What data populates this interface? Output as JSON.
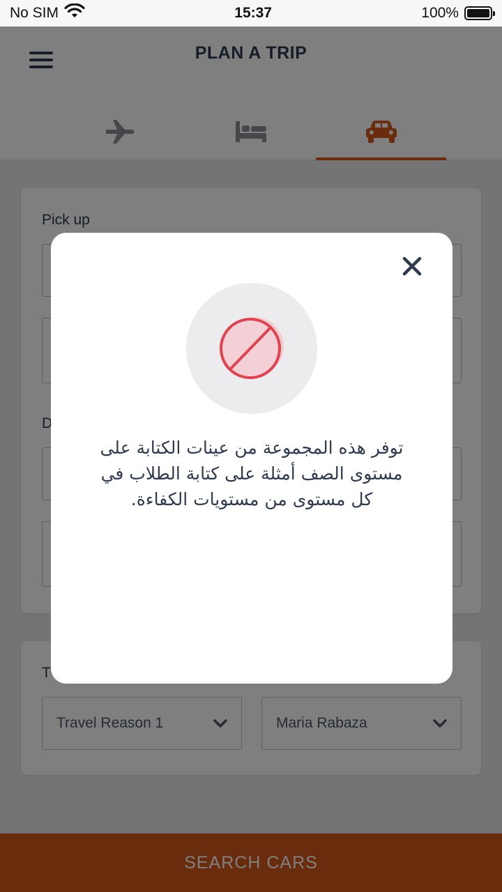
{
  "status_bar": {
    "carrier": "No SIM",
    "time": "15:37",
    "battery": "100%"
  },
  "header": {
    "title": "PLAN A TRIP"
  },
  "tabs": [
    {
      "name": "flights",
      "icon": "airplane-icon",
      "active": false
    },
    {
      "name": "hotels",
      "icon": "bed-icon",
      "active": false
    },
    {
      "name": "cars",
      "icon": "car-icon",
      "active": true
    }
  ],
  "form": {
    "pickup_label": "Pick up",
    "dropoff_label_partial": "D",
    "travel_label_partial": "T",
    "reason_value": "Travel Reason 1",
    "traveler_value": "Maria Rabaza"
  },
  "search_button": {
    "label": "SEARCH CARS"
  },
  "modal": {
    "icon": "prohibited-icon",
    "message": "توفر هذه المجموعة من عينات الكتابة على مستوى الصف أمثلة على كتابة الطلاب في كل مستوى من مستويات الكفاءة."
  },
  "colors": {
    "accent": "#d35a1d",
    "text_dark": "#2e3a4f",
    "danger": "#e0434f"
  }
}
